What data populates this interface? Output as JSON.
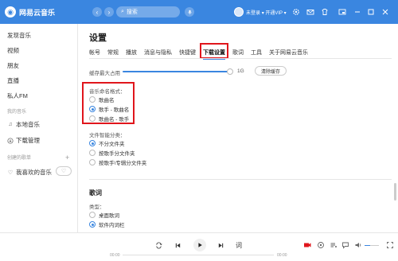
{
  "app": {
    "logo_glyph": "◉",
    "name": "网易云音乐"
  },
  "titlebar": {
    "back": "‹",
    "forward": "›",
    "search_placeholder": "搜索",
    "user_name": "未登录",
    "vip_label": "开通VIP"
  },
  "sidebar": {
    "items": [
      {
        "label": "发现音乐"
      },
      {
        "label": "视频"
      },
      {
        "label": "朋友"
      },
      {
        "label": "直播"
      },
      {
        "label": "私人FM"
      }
    ],
    "group_my_music": "我的音乐",
    "my_items": [
      {
        "label": "本地音乐",
        "icon": "music-note-icon"
      },
      {
        "label": "下载管理",
        "icon": "download-icon"
      }
    ],
    "group_playlists": "创建的歌单",
    "plus": "+",
    "favorites": {
      "label": "我喜欢的音乐",
      "icon": "heart-icon"
    }
  },
  "settings": {
    "title": "设置",
    "tabs": [
      "帐号",
      "常规",
      "播放",
      "消息与隐私",
      "快捷键",
      "下载设置",
      "歌词",
      "工具",
      "关于网易云音乐"
    ],
    "active_tab": "下载设置",
    "cache_label": "缓存最大占用",
    "cache_value": "1G",
    "cache_fraction": 0.98,
    "clear_cache_button": "清除缓存",
    "naming_label": "音乐命名格式：",
    "naming_options": [
      {
        "label": "歌曲名",
        "selected": false
      },
      {
        "label": "歌手 - 歌曲名",
        "selected": true
      },
      {
        "label": "歌曲名 - 歌手",
        "selected": false
      }
    ],
    "folder_label": "文件智能分类：",
    "folder_options": [
      {
        "label": "不分文件夹",
        "selected": true
      },
      {
        "label": "按歌手分文件夹",
        "selected": false
      },
      {
        "label": "按歌手\\专辑分文件夹",
        "selected": false
      }
    ],
    "lyrics_title": "歌词",
    "lyrics_type_label": "类型：",
    "lyrics_options": [
      {
        "label": "桌面歌词",
        "selected": false
      },
      {
        "label": "软件内词栏",
        "selected": true
      }
    ]
  },
  "player": {
    "time_current": "00:00",
    "time_total": "00:00",
    "lyric_button": "词",
    "volume_fraction": 0.4
  },
  "colors": {
    "brand": "#3a86e0",
    "highlight_box": "#e0161c"
  }
}
